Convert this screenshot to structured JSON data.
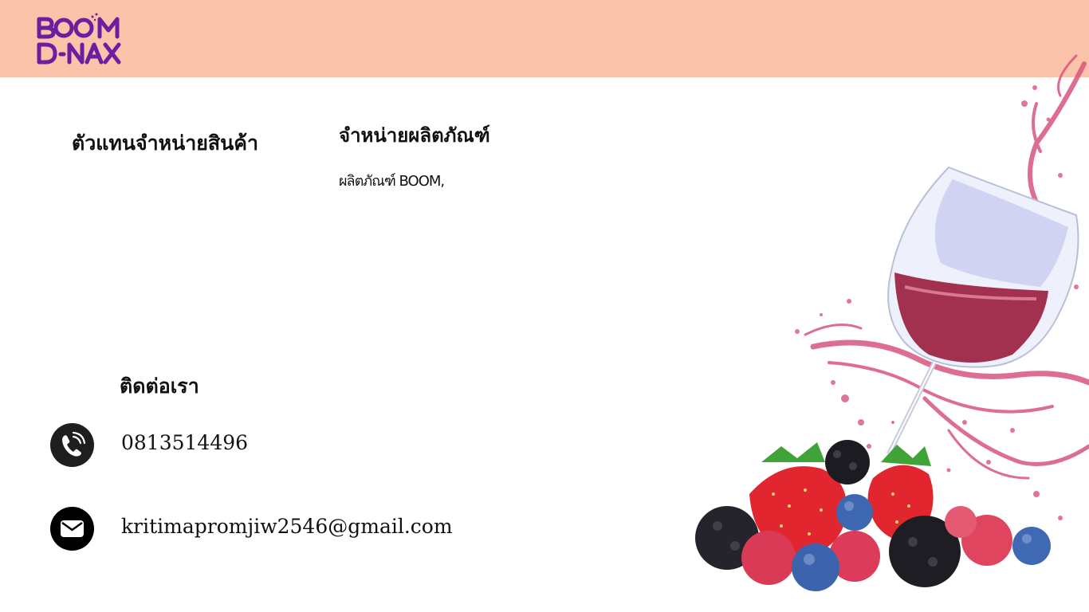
{
  "brand": {
    "logo_line1": "BOOM",
    "logo_line2": "D-NAX",
    "logo_color": "#6b1fa0"
  },
  "header": {
    "background": "#fbc3a9"
  },
  "agent": {
    "title": "ตัวแทนจำหน่ายสินค้า"
  },
  "distribution": {
    "title": "จำหน่ายผลิตภัณฑ์",
    "description": "ผลิตภัณฑ์ BOOM,"
  },
  "contact": {
    "title": "ติดต่อเรา",
    "phone": "0813514496",
    "email": "kritimapromjiw2546@gmail.com",
    "phone_icon": "phone-icon",
    "mail_icon": "mail-icon"
  },
  "illustration": {
    "name": "wine-glass-berries-splash"
  }
}
